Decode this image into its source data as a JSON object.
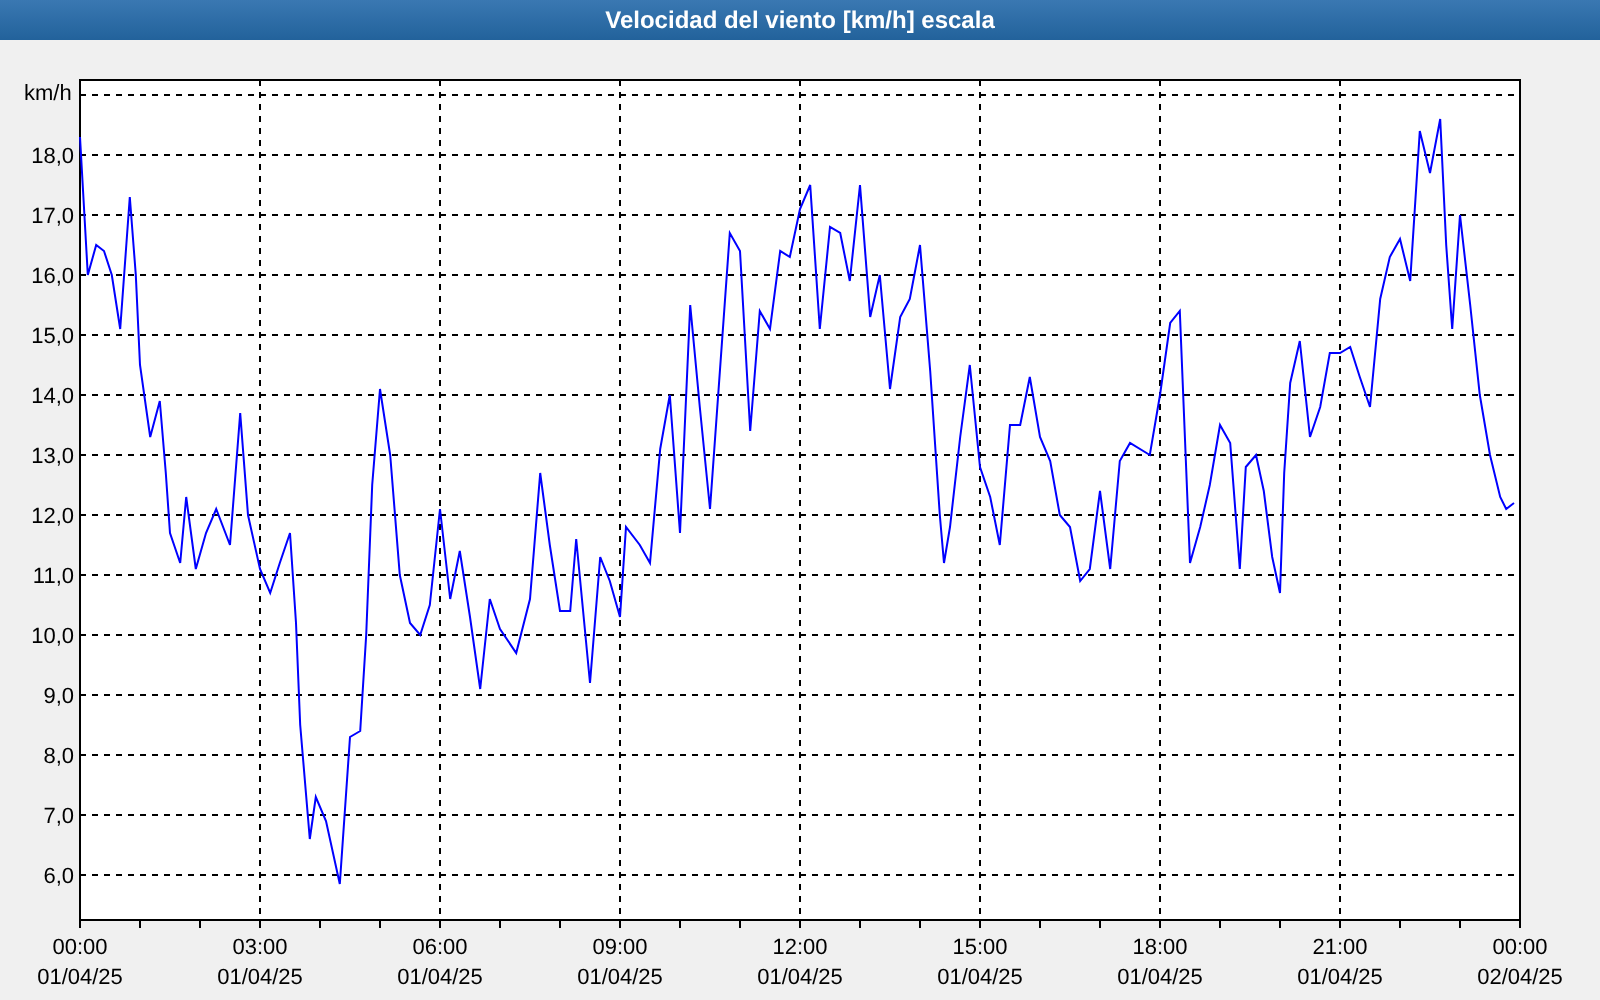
{
  "window": {
    "title": "Velocidad del viento [km/h] escala"
  },
  "chart": {
    "chart_data": {
      "type": "line",
      "ylabel": "km/h",
      "grid": true,
      "xlim": [
        0,
        24
      ],
      "ylim": [
        5.25,
        19.25
      ],
      "xticks": [
        {
          "value": 0,
          "label": "00:00"
        },
        {
          "value": 3,
          "label": "03:00"
        },
        {
          "value": 6,
          "label": "06:00"
        },
        {
          "value": 9,
          "label": "09:00"
        },
        {
          "value": 12,
          "label": "12:00"
        },
        {
          "value": 15,
          "label": "15:00"
        },
        {
          "value": 18,
          "label": "18:00"
        },
        {
          "value": 21,
          "label": "21:00"
        },
        {
          "value": 24,
          "label": "00:00"
        }
      ],
      "yticks": [
        {
          "value": 6,
          "label": "6,0"
        },
        {
          "value": 7,
          "label": "7,0"
        },
        {
          "value": 8,
          "label": "8,0"
        },
        {
          "value": 9,
          "label": "9,0"
        },
        {
          "value": 10,
          "label": "10,0"
        },
        {
          "value": 11,
          "label": "11,0"
        },
        {
          "value": 12,
          "label": "12,0"
        },
        {
          "value": 13,
          "label": "13,0"
        },
        {
          "value": 14,
          "label": "14,0"
        },
        {
          "value": 15,
          "label": "15,0"
        },
        {
          "value": 16,
          "label": "16,0"
        },
        {
          "value": 17,
          "label": "17,0"
        },
        {
          "value": 18,
          "label": "18,0"
        }
      ],
      "x": [
        0,
        0.13,
        0.27,
        0.4,
        0.53,
        0.67,
        0.83,
        0.93,
        1.0,
        1.17,
        1.33,
        1.43,
        1.5,
        1.67,
        1.77,
        1.93,
        2.1,
        2.27,
        2.5,
        2.67,
        2.8,
        3.0,
        3.17,
        3.33,
        3.5,
        3.6,
        3.67,
        3.83,
        3.93,
        4.1,
        4.33,
        4.5,
        4.67,
        4.77,
        4.87,
        5.0,
        5.17,
        5.33,
        5.5,
        5.67,
        5.83,
        6.0,
        6.17,
        6.33,
        6.5,
        6.67,
        6.83,
        7.0,
        7.27,
        7.5,
        7.67,
        7.83,
        8.0,
        8.17,
        8.27,
        8.5,
        8.67,
        8.83,
        9.0,
        9.1,
        9.33,
        9.5,
        9.67,
        9.83,
        10.0,
        10.17,
        10.33,
        10.5,
        10.83,
        11.0,
        11.17,
        11.33,
        11.5,
        11.67,
        11.83,
        12.0,
        12.17,
        12.33,
        12.5,
        12.67,
        12.83,
        13.0,
        13.17,
        13.33,
        13.5,
        13.67,
        13.83,
        14.0,
        14.17,
        14.33,
        14.4,
        14.5,
        14.67,
        14.83,
        15.0,
        15.17,
        15.33,
        15.5,
        15.67,
        15.83,
        16.0,
        16.17,
        16.33,
        16.5,
        16.67,
        16.83,
        17.0,
        17.17,
        17.33,
        17.5,
        17.83,
        18.0,
        18.17,
        18.33,
        18.5,
        18.67,
        18.83,
        19.0,
        19.17,
        19.33,
        19.43,
        19.6,
        19.73,
        19.87,
        20.0,
        20.07,
        20.17,
        20.33,
        20.5,
        20.67,
        20.83,
        21.0,
        21.17,
        21.33,
        21.5,
        21.67,
        21.83,
        22.0,
        22.17,
        22.33,
        22.5,
        22.67,
        22.77,
        22.87,
        23.0,
        23.17,
        23.33,
        23.5,
        23.67,
        23.77,
        23.9
      ],
      "series": [
        {
          "color": "#0000ff",
          "values": [
            18.3,
            16.0,
            16.5,
            16.4,
            16.0,
            15.1,
            17.3,
            16.0,
            14.5,
            13.3,
            13.9,
            12.7,
            11.7,
            11.2,
            12.3,
            11.1,
            11.7,
            12.1,
            11.5,
            13.7,
            12.0,
            11.1,
            10.7,
            11.2,
            11.7,
            10.2,
            8.5,
            6.6,
            7.3,
            6.9,
            5.85,
            8.3,
            8.4,
            10.0,
            12.5,
            14.1,
            13.0,
            11.0,
            10.2,
            10.0,
            10.5,
            12.1,
            10.6,
            11.4,
            10.3,
            9.1,
            10.6,
            10.1,
            9.7,
            10.6,
            12.7,
            11.5,
            10.4,
            10.4,
            11.6,
            9.2,
            11.3,
            10.9,
            10.3,
            11.8,
            11.5,
            11.2,
            13.1,
            14.0,
            11.7,
            15.5,
            13.8,
            12.1,
            16.7,
            16.4,
            13.4,
            15.4,
            15.1,
            16.4,
            16.3,
            17.1,
            17.5,
            15.1,
            16.8,
            16.7,
            15.9,
            17.5,
            15.3,
            16.0,
            14.1,
            15.3,
            15.6,
            16.5,
            14.4,
            12.0,
            11.2,
            11.8,
            13.3,
            14.5,
            12.8,
            12.3,
            11.5,
            13.5,
            13.5,
            14.3,
            13.3,
            12.9,
            12.0,
            11.8,
            10.9,
            11.1,
            12.4,
            11.1,
            12.9,
            13.2,
            13.0,
            14.0,
            15.2,
            15.4,
            11.2,
            11.8,
            12.5,
            13.5,
            13.2,
            11.1,
            12.8,
            13.0,
            12.4,
            11.3,
            10.7,
            12.7,
            14.2,
            14.9,
            13.3,
            13.8,
            14.7,
            14.7,
            14.8,
            14.3,
            13.8,
            15.6,
            16.3,
            16.6,
            15.9,
            18.4,
            17.7,
            18.6,
            16.5,
            15.1,
            17.0,
            15.5,
            14.0,
            13.0,
            12.3,
            12.1,
            12.2
          ]
        }
      ]
    },
    "tick_dates": [
      "01/04/25",
      "01/04/25",
      "01/04/25",
      "01/04/25",
      "01/04/25",
      "01/04/25",
      "01/04/25",
      "01/04/25",
      "02/04/25"
    ]
  }
}
